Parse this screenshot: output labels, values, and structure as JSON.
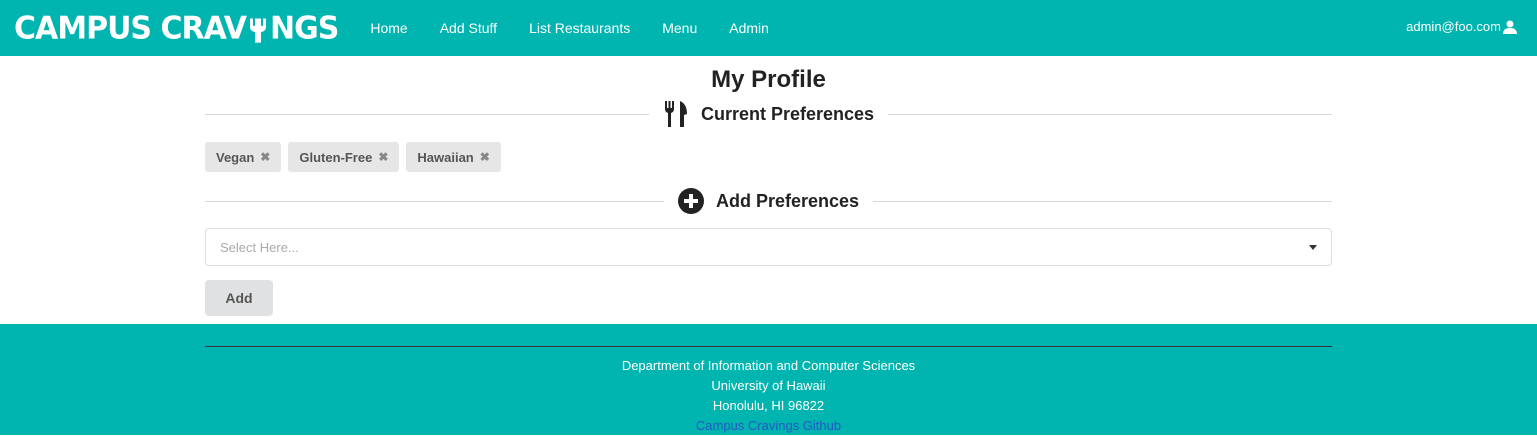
{
  "navbar": {
    "brand": "CAMPUS CRAVINGS",
    "brand_left": "CAMPUS CRAV",
    "brand_right": "NGS",
    "items": [
      {
        "label": "Home"
      },
      {
        "label": "Add Stuff"
      },
      {
        "label": "List Restaurants"
      },
      {
        "label": "Menu"
      },
      {
        "label": "Admin"
      }
    ],
    "user": "admin@foo.com"
  },
  "main": {
    "title": "My Profile",
    "current_header": "Current Preferences",
    "tags": [
      {
        "label": "Vegan"
      },
      {
        "label": "Gluten-Free"
      },
      {
        "label": "Hawaiian"
      }
    ],
    "add_header": "Add Preferences",
    "select_placeholder": "Select Here...",
    "add_button": "Add"
  },
  "footer": {
    "dept": "Department of Information and Computer Sciences",
    "university": "University of Hawaii",
    "address": "Honolulu, HI 96822",
    "link": "Campus Cravings Github"
  },
  "colors": {
    "primary": "#00b4b0",
    "link": "#2a56c4"
  }
}
